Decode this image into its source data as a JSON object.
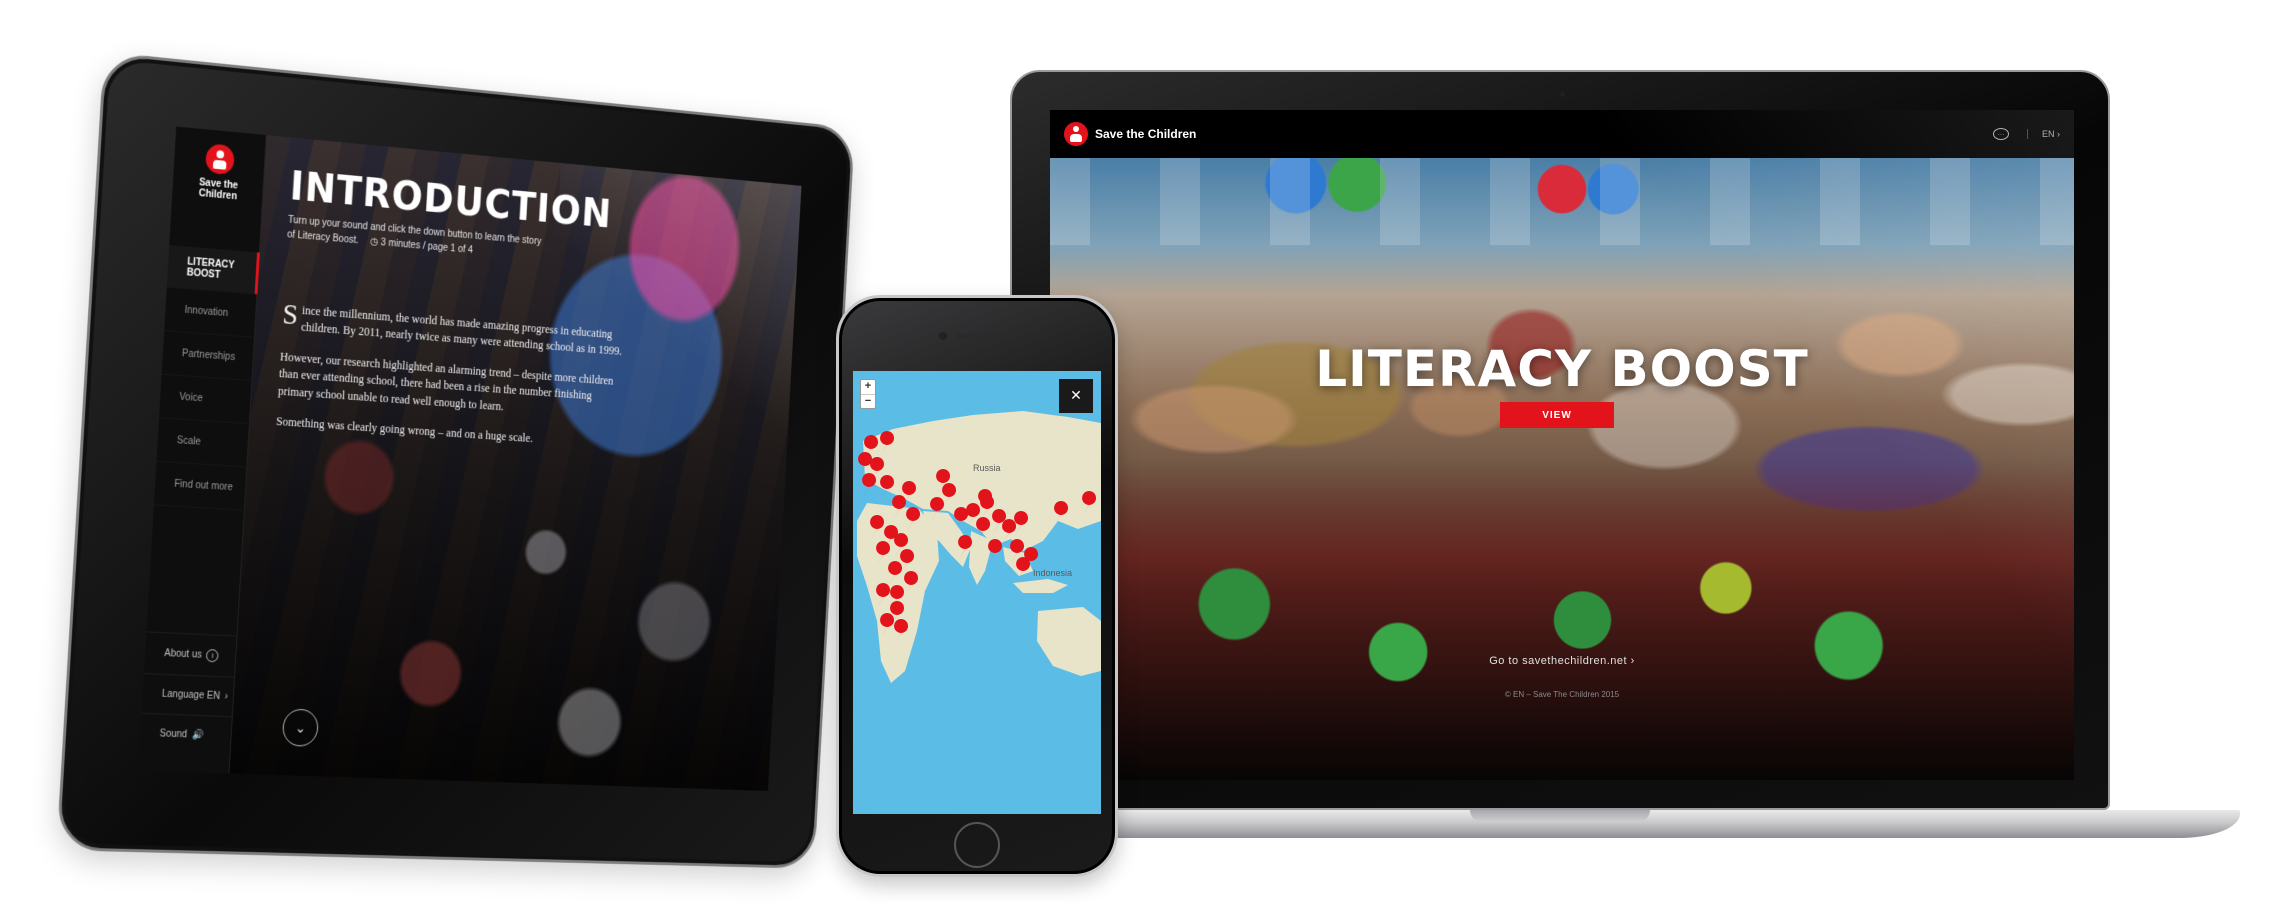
{
  "colors": {
    "brand_red": "#e3131b",
    "sidebar_bg": "#0e0e0e",
    "ocean": "#5bbde6",
    "land": "#e8e4c9"
  },
  "tablet": {
    "brand": "Save the Children",
    "nav": [
      {
        "label": "LITERACY BOOST",
        "active": true
      },
      {
        "label": "Innovation"
      },
      {
        "label": "Partnerships"
      },
      {
        "label": "Voice"
      },
      {
        "label": "Scale"
      },
      {
        "label": "Find out more"
      }
    ],
    "footer": {
      "about": "About us",
      "language": "Language EN",
      "language_chevron": "›",
      "sound": "Sound",
      "about_icon": "info-icon",
      "sound_icon": "speaker-icon"
    },
    "page_title": "INTRODUCTION",
    "intro_line": "Turn up your sound and click the down button to learn the story of",
    "intro_story": "Literacy Boost.",
    "intro_meta": "3 minutes / page 1 of 4",
    "body": [
      {
        "drop_cap": "S",
        "text": "ince the millennium, the world has made amazing progress in educating children. By 2011, nearly twice as many were attending school as in 1999."
      },
      {
        "text": "However, our research highlighted an alarming trend – despite more children than ever attending school, there had been a rise in the number finishing primary school unable to read well enough to learn."
      },
      {
        "text": "Something was clearly going wrong – and on a huge scale."
      }
    ],
    "down_button": "⌄"
  },
  "phone": {
    "zoom_in": "+",
    "zoom_out": "−",
    "close": "✕",
    "map_labels": {
      "russia": "Russia",
      "indonesia": "Indonesia"
    }
  },
  "laptop": {
    "brand": "Save the Children",
    "lang": "EN",
    "lang_chevron": "›",
    "hero_title": "LITERACY BOOST",
    "view_button": "VIEW",
    "goto_text": "Go to savethechildren.net",
    "goto_chevron": "›",
    "copyright": "© EN – Save The Children 2015"
  }
}
